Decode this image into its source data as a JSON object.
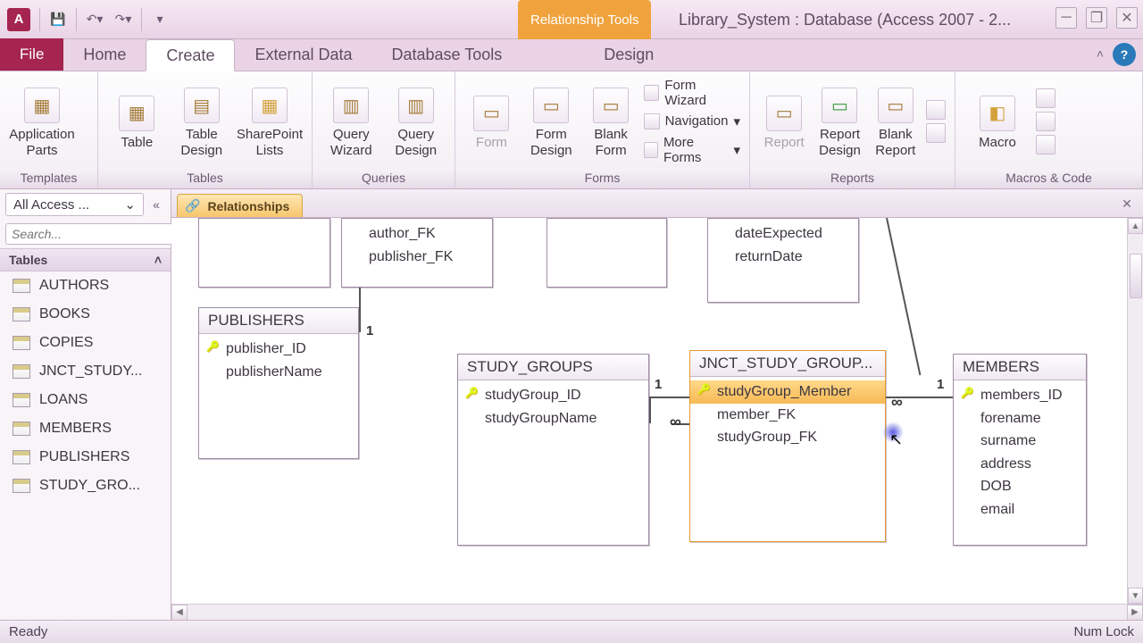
{
  "app_icon_letter": "A",
  "contextual_tab": "Relationship Tools",
  "window_title": "Library_System : Database (Access 2007 - 2...",
  "tabs": {
    "file": "File",
    "home": "Home",
    "create": "Create",
    "external": "External Data",
    "dbtools": "Database Tools",
    "design": "Design"
  },
  "ribbon": {
    "templates": {
      "label": "Templates",
      "app_parts": "Application\nParts"
    },
    "tables": {
      "label": "Tables",
      "table": "Table",
      "table_design": "Table\nDesign",
      "sp_lists": "SharePoint\nLists"
    },
    "queries": {
      "label": "Queries",
      "wizard": "Query\nWizard",
      "design": "Query\nDesign"
    },
    "forms": {
      "label": "Forms",
      "form": "Form",
      "form_design": "Form\nDesign",
      "blank": "Blank\nForm",
      "wizard": "Form Wizard",
      "nav": "Navigation",
      "more": "More Forms"
    },
    "reports": {
      "label": "Reports",
      "report": "Report",
      "design": "Report\nDesign",
      "blank": "Blank\nReport"
    },
    "macros": {
      "label": "Macros & Code",
      "macro": "Macro"
    }
  },
  "nav": {
    "title": "All Access ...",
    "search_placeholder": "Search...",
    "section": "Tables",
    "items": [
      "AUTHORS",
      "BOOKS",
      "COPIES",
      "JNCT_STUDY...",
      "LOANS",
      "MEMBERS",
      "PUBLISHERS",
      "STUDY_GRO..."
    ]
  },
  "doc_tab": "Relationships",
  "canvas_tables": {
    "books_partial": {
      "fields": [
        "author_FK",
        "publisher_FK"
      ]
    },
    "loans_partial": {
      "fields": [
        "dateExpected",
        "returnDate"
      ]
    },
    "publishers": {
      "title": "PUBLISHERS",
      "fields": [
        {
          "n": "publisher_ID",
          "pk": true
        },
        {
          "n": "publisherName"
        }
      ]
    },
    "study_groups": {
      "title": "STUDY_GROUPS",
      "fields": [
        {
          "n": "studyGroup_ID",
          "pk": true
        },
        {
          "n": "studyGroupName"
        }
      ]
    },
    "jnct": {
      "title": "JNCT_STUDY_GROUP...",
      "fields": [
        {
          "n": "studyGroup_Member",
          "pk": true,
          "sel": true
        },
        {
          "n": "member_FK"
        },
        {
          "n": "studyGroup_FK"
        }
      ]
    },
    "members": {
      "title": "MEMBERS",
      "fields": [
        {
          "n": "members_ID",
          "pk": true
        },
        {
          "n": "forename"
        },
        {
          "n": "surname"
        },
        {
          "n": "address"
        },
        {
          "n": "DOB"
        },
        {
          "n": "email"
        }
      ]
    }
  },
  "cardinality": {
    "one": "1",
    "many": "∞"
  },
  "status": {
    "left": "Ready",
    "right": "Num Lock"
  }
}
